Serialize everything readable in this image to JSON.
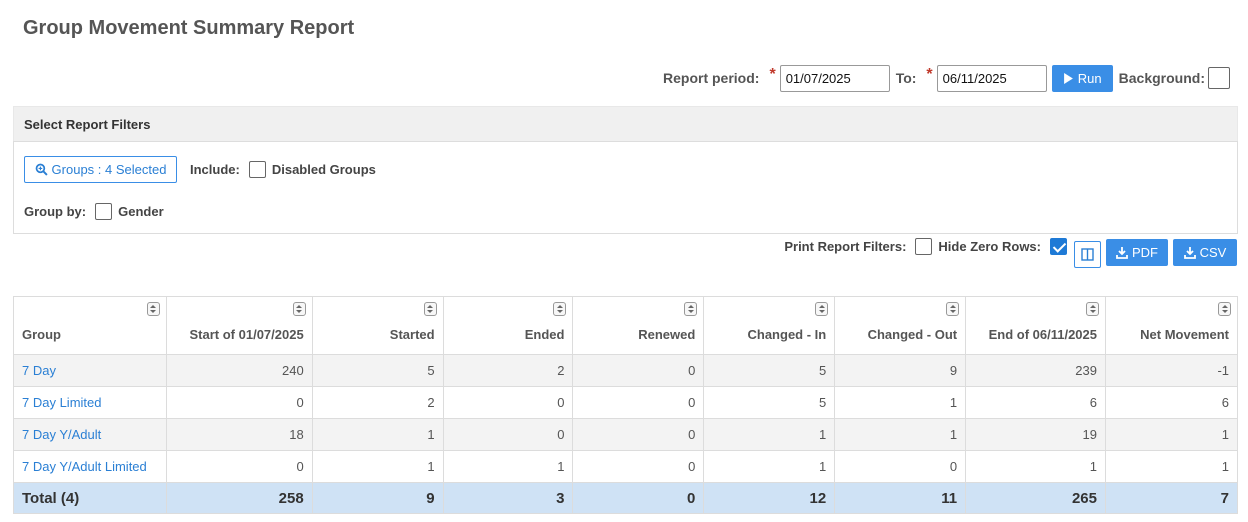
{
  "page_title": "Group Movement Summary Report",
  "report_period": {
    "label": "Report period:",
    "required_mark": "*",
    "from_value": "01/07/2025",
    "to_label": "To:",
    "to_value": "06/11/2025",
    "run_label": "Run",
    "background_label": "Background:"
  },
  "filters": {
    "header": "Select Report Filters",
    "groups_button": "Groups : 4 Selected",
    "include_label": "Include:",
    "disabled_groups_label": "Disabled Groups",
    "group_by_label": "Group by:",
    "gender_label": "Gender"
  },
  "print_options": {
    "print_filters_label": "Print Report Filters:",
    "hide_zero_rows_label": "Hide Zero Rows:",
    "pdf_label": "PDF",
    "csv_label": "CSV"
  },
  "table": {
    "columns": [
      "Group",
      "Start of 01/07/2025",
      "Started",
      "Ended",
      "Renewed",
      "Changed - In",
      "Changed - Out",
      "End of 06/11/2025",
      "Net Movement"
    ],
    "rows": [
      [
        "7 Day",
        "240",
        "5",
        "2",
        "0",
        "5",
        "9",
        "239",
        "-1"
      ],
      [
        "7 Day Limited",
        "0",
        "2",
        "0",
        "0",
        "5",
        "1",
        "6",
        "6"
      ],
      [
        "7 Day Y/Adult",
        "18",
        "1",
        "0",
        "0",
        "1",
        "1",
        "19",
        "1"
      ],
      [
        "7 Day Y/Adult Limited",
        "0",
        "1",
        "1",
        "0",
        "1",
        "0",
        "1",
        "1"
      ]
    ],
    "total": [
      "Total (4)",
      "258",
      "9",
      "3",
      "0",
      "12",
      "11",
      "265",
      "7"
    ]
  },
  "colors": {
    "accent": "#3a8ee6",
    "link": "#2a7fd4",
    "total_row": "#cfe2f5",
    "required": "#c0392b"
  }
}
